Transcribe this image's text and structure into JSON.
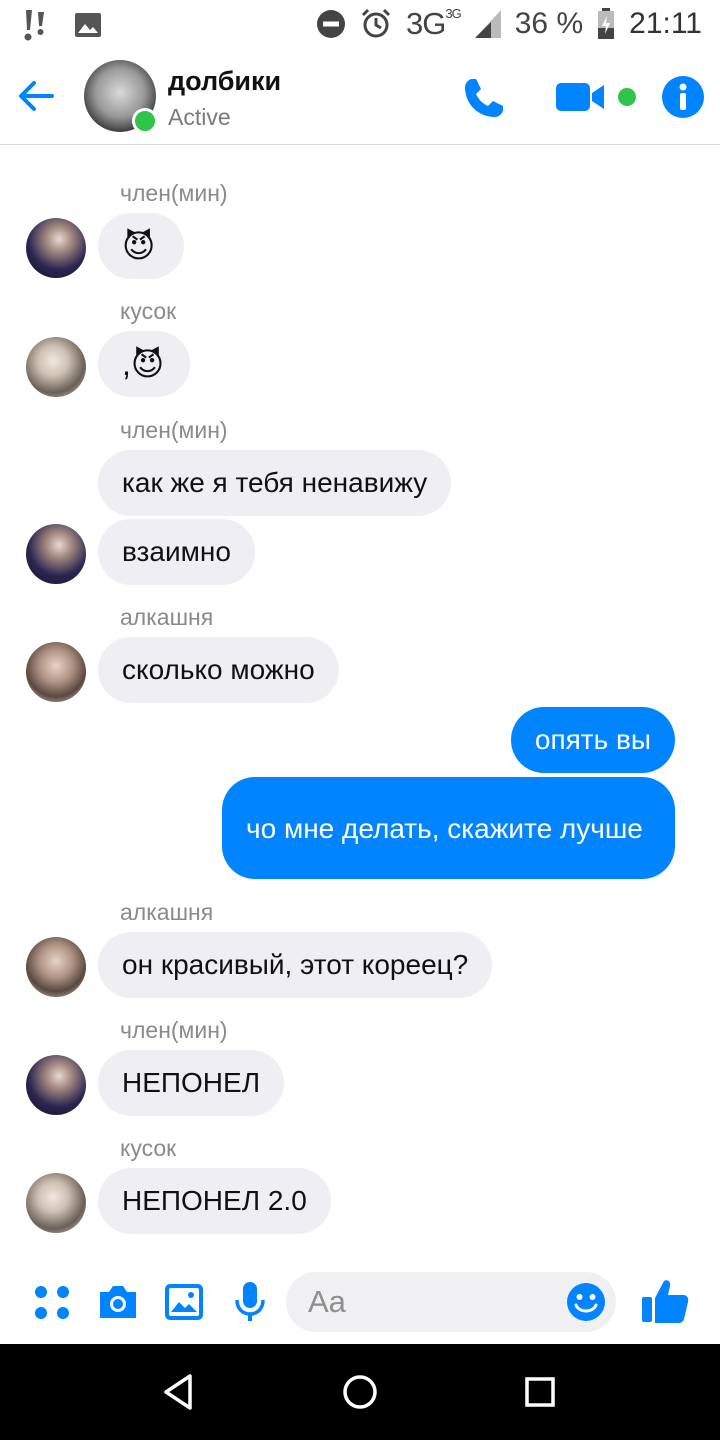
{
  "status_bar": {
    "network": "3G",
    "network_sup": "3G",
    "battery": "36 %",
    "time": "21:11"
  },
  "header": {
    "title": "долбики",
    "status": "Active"
  },
  "messages": [
    {
      "sender": "член(мин)",
      "text": "😈",
      "mine": false
    },
    {
      "sender": "кусок",
      "text": ",😈",
      "mine": false
    },
    {
      "sender": "член(мин)",
      "text": "как же я тебя ненавижу",
      "mine": false
    },
    {
      "sender": "",
      "text": "взаимно",
      "mine": false
    },
    {
      "sender": "алкашня",
      "text": "сколько можно",
      "mine": false
    },
    {
      "sender": "",
      "text": "опять вы",
      "mine": true
    },
    {
      "sender": "",
      "text": "чо мне делать, скажите лучше",
      "mine": true
    },
    {
      "sender": "алкашня",
      "text": "он красивый, этот кореец?",
      "mine": false
    },
    {
      "sender": "член(мин)",
      "text": "НЕПОНЕЛ",
      "mine": false
    },
    {
      "sender": "кусок",
      "text": "НЕПОНЕЛ 2.0",
      "mine": false
    }
  ],
  "composer": {
    "placeholder": "Aa"
  },
  "colors": {
    "accent": "#0084ff",
    "online": "#31c44a",
    "incoming_bubble": "#efeff3"
  }
}
